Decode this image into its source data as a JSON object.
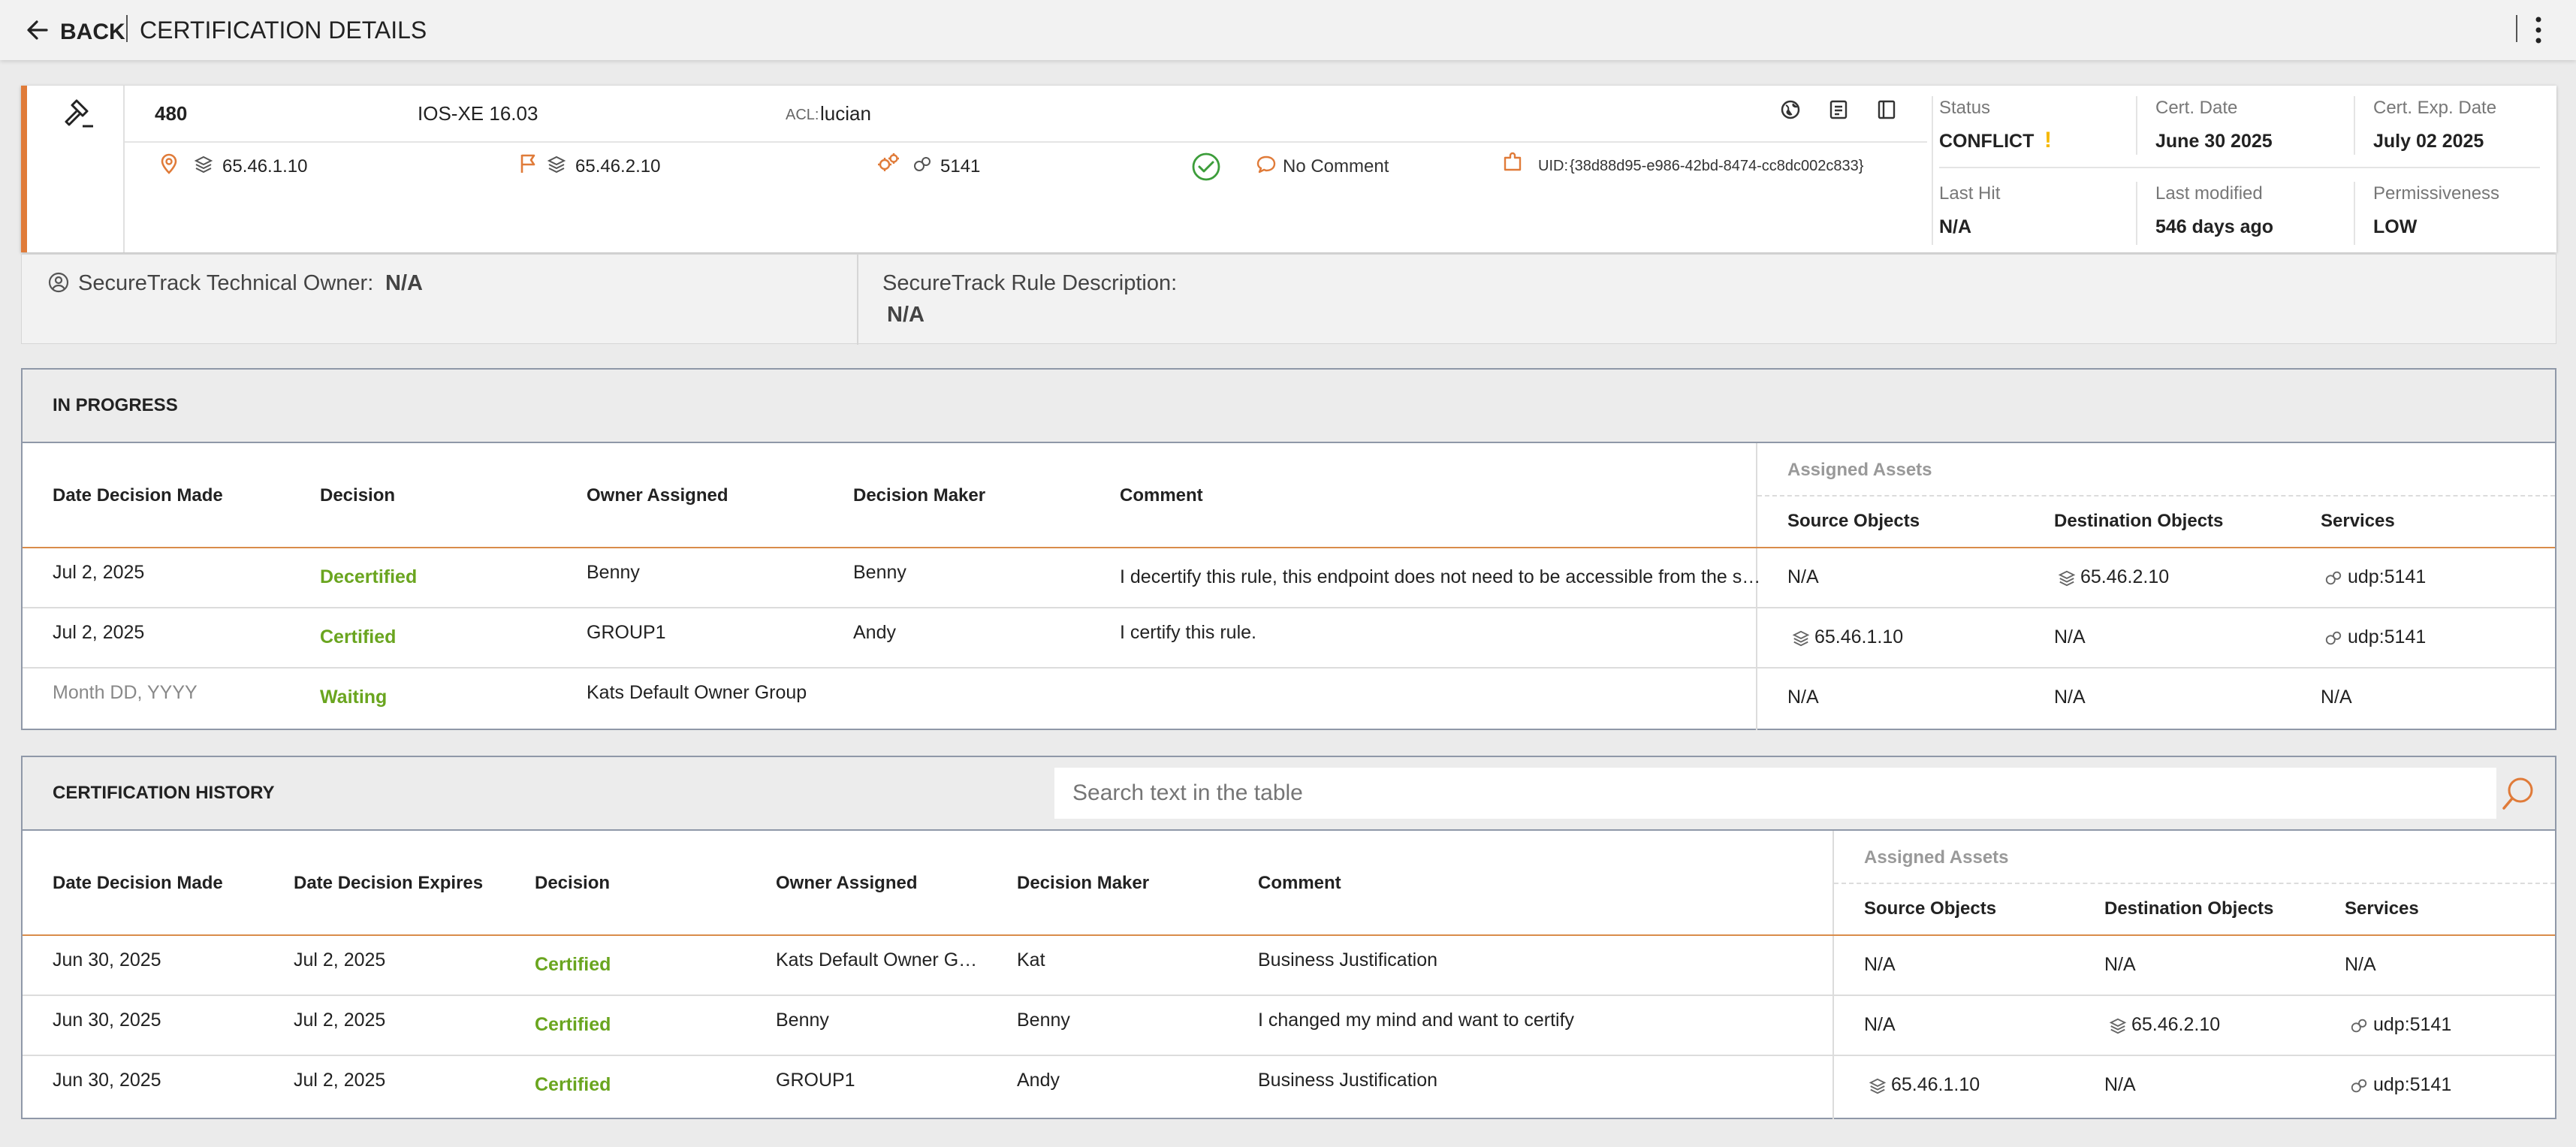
{
  "topbar": {
    "back_label": "BACK",
    "title": "CERTIFICATION DETAILS"
  },
  "rule": {
    "number": "480",
    "os": "IOS-XE 16.03",
    "acl_prefix": "ACL:",
    "acl_value": "lucian",
    "source": "65.46.1.10",
    "destination": "65.46.2.10",
    "service": "5141",
    "comment": "No Comment",
    "uid_label": "UID:",
    "uid": "{38d88d95-e986-42bd-8474-cc8dc002c833}"
  },
  "stats": {
    "status_label": "Status",
    "status_value": "CONFLICT",
    "status_mark": "!",
    "cert_date_label": "Cert. Date",
    "cert_date_value": "June 30 2025",
    "cert_exp_label": "Cert. Exp. Date",
    "cert_exp_value": "July 02 2025",
    "last_hit_label": "Last Hit",
    "last_hit_value": "N/A",
    "last_mod_label": "Last modified",
    "last_mod_value": "546 days ago",
    "perm_label": "Permissiveness",
    "perm_value": "LOW"
  },
  "owner": {
    "tech_owner_label": "SecureTrack Technical Owner:",
    "tech_owner_value": "N/A",
    "rule_desc_label": "SecureTrack Rule Description:",
    "rule_desc_value": "N/A"
  },
  "in_progress": {
    "title": "IN PROGRESS",
    "assigned_assets": "Assigned Assets",
    "headers": {
      "date": "Date Decision Made",
      "decision": "Decision",
      "owner": "Owner Assigned",
      "maker": "Decision Maker",
      "comment": "Comment",
      "src": "Source Objects",
      "dst": "Destination Objects",
      "svc": "Services"
    },
    "rows": [
      {
        "date": "Jul 2, 2025",
        "decision": "Decertified",
        "owner": "Benny",
        "maker": "Benny",
        "comment": "I decertify this rule, this endpoint does not need to be accessible from the s…",
        "src": "N/A",
        "dst": "65.46.2.10",
        "svc": "udp:5141"
      },
      {
        "date": "Jul 2, 2025",
        "decision": "Certified",
        "owner": "GROUP1",
        "maker": "Andy",
        "comment": "I certify this rule.",
        "src": "65.46.1.10",
        "dst": "N/A",
        "svc": "udp:5141"
      },
      {
        "date": "Month DD, YYYY",
        "decision": "Waiting",
        "owner": "Kats Default Owner Group",
        "maker": "",
        "comment": "",
        "src": "N/A",
        "dst": "N/A",
        "svc": "N/A"
      }
    ]
  },
  "history": {
    "title": "CERTIFICATION HISTORY",
    "search_placeholder": "Search text in the table",
    "assigned_assets": "Assigned Assets",
    "headers": {
      "date": "Date Decision Made",
      "expires": "Date Decision Expires",
      "decision": "Decision",
      "owner": "Owner Assigned",
      "maker": "Decision Maker",
      "comment": "Comment",
      "src": "Source Objects",
      "dst": "Destination Objects",
      "svc": "Services"
    },
    "rows": [
      {
        "date": "Jun 30, 2025",
        "expires": "Jul 2, 2025",
        "decision": "Certified",
        "owner": "Kats Default Owner G…",
        "maker": "Kat",
        "comment": "Business Justification",
        "src": "N/A",
        "dst": "N/A",
        "svc": "N/A"
      },
      {
        "date": "Jun 30, 2025",
        "expires": "Jul 2, 2025",
        "decision": "Certified",
        "owner": "Benny",
        "maker": "Benny",
        "comment": "I changed my mind and want to certify",
        "src": "N/A",
        "dst": "65.46.2.10",
        "svc": "udp:5141"
      },
      {
        "date": "Jun 30, 2025",
        "expires": "Jul 2, 2025",
        "decision": "Certified",
        "owner": "GROUP1",
        "maker": "Andy",
        "comment": "Business Justification",
        "src": "65.46.1.10",
        "dst": "N/A",
        "svc": "udp:5141"
      }
    ]
  },
  "colors": {
    "accent": "#e07b39",
    "certified_green": "#6aa51f",
    "warning": "#f5b800",
    "panel_border": "#8f98a8"
  }
}
